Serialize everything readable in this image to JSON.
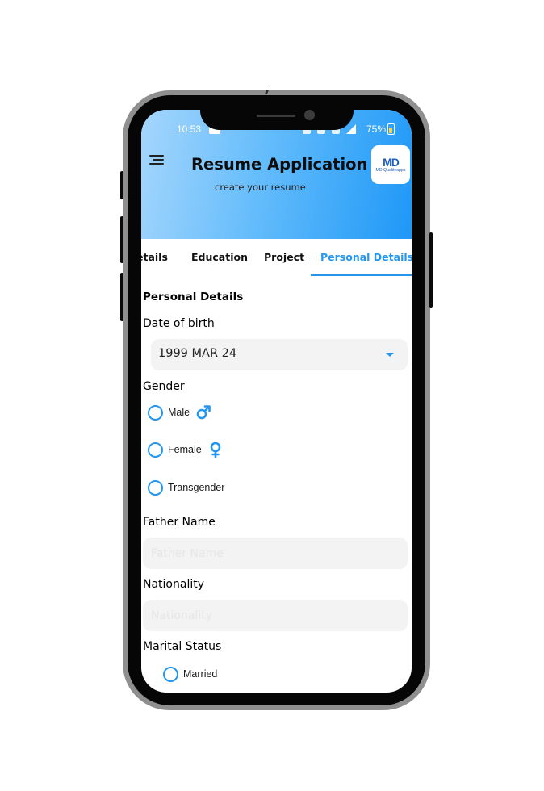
{
  "status_bar": {
    "time": "10:53",
    "battery": "75%"
  },
  "header": {
    "title": "Resume Application",
    "subtitle": "create your resume",
    "menu_icon": "menu-icon",
    "logo": {
      "mark": "MD",
      "text": "MD Qualityapps"
    },
    "gradient": [
      "#a5d6fd",
      "#1e98f7"
    ]
  },
  "tabs": {
    "items": [
      {
        "label": "etails"
      },
      {
        "label": "Education"
      },
      {
        "label": "Project"
      },
      {
        "label": "Personal Details"
      }
    ],
    "active_index": 3,
    "accent_color": "#2496f0"
  },
  "form": {
    "section_title": "Personal Details",
    "dob": {
      "label": "Date of birth",
      "value": "1999 MAR 24"
    },
    "gender": {
      "label": "Gender",
      "options": [
        {
          "label": "Male",
          "icon": "male-icon"
        },
        {
          "label": "Female",
          "icon": "female-icon"
        },
        {
          "label": "Transgender"
        }
      ]
    },
    "father_name": {
      "label": "Father Name",
      "placeholder": "Father Name",
      "value": ""
    },
    "nationality": {
      "label": "Nationality",
      "placeholder": "Nationality",
      "value": ""
    },
    "marital_status": {
      "label": "Marital Status",
      "options": [
        {
          "label": "Married"
        }
      ]
    }
  }
}
